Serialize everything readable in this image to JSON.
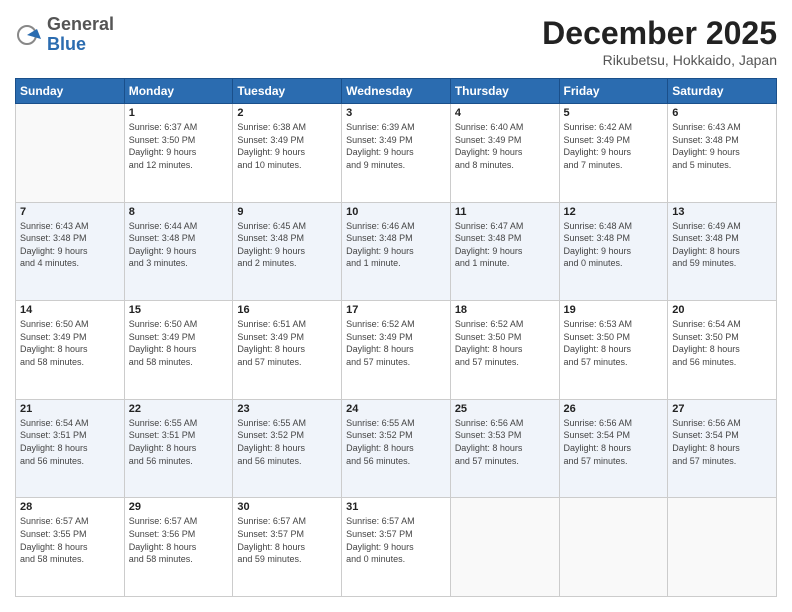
{
  "header": {
    "logo_general": "General",
    "logo_blue": "Blue",
    "month_title": "December 2025",
    "location": "Rikubetsu, Hokkaido, Japan"
  },
  "days_of_week": [
    "Sunday",
    "Monday",
    "Tuesday",
    "Wednesday",
    "Thursday",
    "Friday",
    "Saturday"
  ],
  "weeks": [
    [
      {
        "day": "",
        "info": ""
      },
      {
        "day": "1",
        "info": "Sunrise: 6:37 AM\nSunset: 3:50 PM\nDaylight: 9 hours\nand 12 minutes."
      },
      {
        "day": "2",
        "info": "Sunrise: 6:38 AM\nSunset: 3:49 PM\nDaylight: 9 hours\nand 10 minutes."
      },
      {
        "day": "3",
        "info": "Sunrise: 6:39 AM\nSunset: 3:49 PM\nDaylight: 9 hours\nand 9 minutes."
      },
      {
        "day": "4",
        "info": "Sunrise: 6:40 AM\nSunset: 3:49 PM\nDaylight: 9 hours\nand 8 minutes."
      },
      {
        "day": "5",
        "info": "Sunrise: 6:42 AM\nSunset: 3:49 PM\nDaylight: 9 hours\nand 7 minutes."
      },
      {
        "day": "6",
        "info": "Sunrise: 6:43 AM\nSunset: 3:48 PM\nDaylight: 9 hours\nand 5 minutes."
      }
    ],
    [
      {
        "day": "7",
        "info": "Sunrise: 6:43 AM\nSunset: 3:48 PM\nDaylight: 9 hours\nand 4 minutes."
      },
      {
        "day": "8",
        "info": "Sunrise: 6:44 AM\nSunset: 3:48 PM\nDaylight: 9 hours\nand 3 minutes."
      },
      {
        "day": "9",
        "info": "Sunrise: 6:45 AM\nSunset: 3:48 PM\nDaylight: 9 hours\nand 2 minutes."
      },
      {
        "day": "10",
        "info": "Sunrise: 6:46 AM\nSunset: 3:48 PM\nDaylight: 9 hours\nand 1 minute."
      },
      {
        "day": "11",
        "info": "Sunrise: 6:47 AM\nSunset: 3:48 PM\nDaylight: 9 hours\nand 1 minute."
      },
      {
        "day": "12",
        "info": "Sunrise: 6:48 AM\nSunset: 3:48 PM\nDaylight: 9 hours\nand 0 minutes."
      },
      {
        "day": "13",
        "info": "Sunrise: 6:49 AM\nSunset: 3:48 PM\nDaylight: 8 hours\nand 59 minutes."
      }
    ],
    [
      {
        "day": "14",
        "info": "Sunrise: 6:50 AM\nSunset: 3:49 PM\nDaylight: 8 hours\nand 58 minutes."
      },
      {
        "day": "15",
        "info": "Sunrise: 6:50 AM\nSunset: 3:49 PM\nDaylight: 8 hours\nand 58 minutes."
      },
      {
        "day": "16",
        "info": "Sunrise: 6:51 AM\nSunset: 3:49 PM\nDaylight: 8 hours\nand 57 minutes."
      },
      {
        "day": "17",
        "info": "Sunrise: 6:52 AM\nSunset: 3:49 PM\nDaylight: 8 hours\nand 57 minutes."
      },
      {
        "day": "18",
        "info": "Sunrise: 6:52 AM\nSunset: 3:50 PM\nDaylight: 8 hours\nand 57 minutes."
      },
      {
        "day": "19",
        "info": "Sunrise: 6:53 AM\nSunset: 3:50 PM\nDaylight: 8 hours\nand 57 minutes."
      },
      {
        "day": "20",
        "info": "Sunrise: 6:54 AM\nSunset: 3:50 PM\nDaylight: 8 hours\nand 56 minutes."
      }
    ],
    [
      {
        "day": "21",
        "info": "Sunrise: 6:54 AM\nSunset: 3:51 PM\nDaylight: 8 hours\nand 56 minutes."
      },
      {
        "day": "22",
        "info": "Sunrise: 6:55 AM\nSunset: 3:51 PM\nDaylight: 8 hours\nand 56 minutes."
      },
      {
        "day": "23",
        "info": "Sunrise: 6:55 AM\nSunset: 3:52 PM\nDaylight: 8 hours\nand 56 minutes."
      },
      {
        "day": "24",
        "info": "Sunrise: 6:55 AM\nSunset: 3:52 PM\nDaylight: 8 hours\nand 56 minutes."
      },
      {
        "day": "25",
        "info": "Sunrise: 6:56 AM\nSunset: 3:53 PM\nDaylight: 8 hours\nand 57 minutes."
      },
      {
        "day": "26",
        "info": "Sunrise: 6:56 AM\nSunset: 3:54 PM\nDaylight: 8 hours\nand 57 minutes."
      },
      {
        "day": "27",
        "info": "Sunrise: 6:56 AM\nSunset: 3:54 PM\nDaylight: 8 hours\nand 57 minutes."
      }
    ],
    [
      {
        "day": "28",
        "info": "Sunrise: 6:57 AM\nSunset: 3:55 PM\nDaylight: 8 hours\nand 58 minutes."
      },
      {
        "day": "29",
        "info": "Sunrise: 6:57 AM\nSunset: 3:56 PM\nDaylight: 8 hours\nand 58 minutes."
      },
      {
        "day": "30",
        "info": "Sunrise: 6:57 AM\nSunset: 3:57 PM\nDaylight: 8 hours\nand 59 minutes."
      },
      {
        "day": "31",
        "info": "Sunrise: 6:57 AM\nSunset: 3:57 PM\nDaylight: 9 hours\nand 0 minutes."
      },
      {
        "day": "",
        "info": ""
      },
      {
        "day": "",
        "info": ""
      },
      {
        "day": "",
        "info": ""
      }
    ]
  ]
}
